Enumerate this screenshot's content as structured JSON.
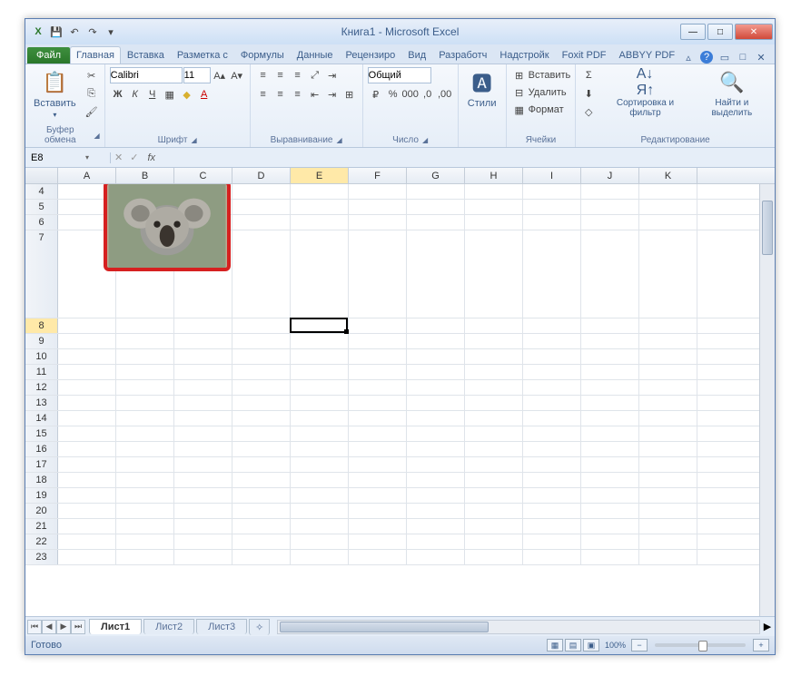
{
  "window": {
    "title": "Книга1 - Microsoft Excel"
  },
  "qat": {
    "excel_icon": "X",
    "save": "💾",
    "undo": "↶",
    "redo": "↷",
    "print": "⎙"
  },
  "tabs": {
    "file": "Файл",
    "items": [
      "Главная",
      "Вставка",
      "Разметка с",
      "Формулы",
      "Данные",
      "Рецензиро",
      "Вид",
      "Разработч",
      "Надстройк",
      "Foxit PDF",
      "ABBYY PDF"
    ],
    "active_index": 0
  },
  "ribbon": {
    "clipboard": {
      "paste": "Вставить",
      "label": "Буфер обмена"
    },
    "font": {
      "name": "Calibri",
      "size": "11",
      "label": "Шрифт"
    },
    "alignment": {
      "label": "Выравнивание"
    },
    "number": {
      "format": "Общий",
      "label": "Число"
    },
    "styles": {
      "btn": "Стили",
      "label": ""
    },
    "cells": {
      "insert": "Вставить",
      "delete": "Удалить",
      "format": "Формат",
      "label": "Ячейки"
    },
    "editing": {
      "sort": "Сортировка и фильтр",
      "find": "Найти и выделить",
      "label": "Редактирование"
    }
  },
  "formula_bar": {
    "name_box": "E8",
    "fx": "fx",
    "value": ""
  },
  "grid": {
    "columns": [
      "A",
      "B",
      "C",
      "D",
      "E",
      "F",
      "G",
      "H",
      "I",
      "J",
      "K"
    ],
    "rows": [
      4,
      5,
      6,
      7,
      8,
      9,
      10,
      11,
      12,
      13,
      14,
      15,
      16,
      17,
      18,
      19,
      20,
      21,
      22,
      23
    ],
    "tall_row": 7,
    "selected_cell": "E8",
    "selected_col": "E",
    "selected_row": 8
  },
  "sheets": {
    "names": [
      "Лист1",
      "Лист2",
      "Лист3"
    ],
    "active": 0
  },
  "status": {
    "ready": "Готово",
    "zoom": "100%"
  },
  "image": {
    "alt": "koala-picture"
  }
}
